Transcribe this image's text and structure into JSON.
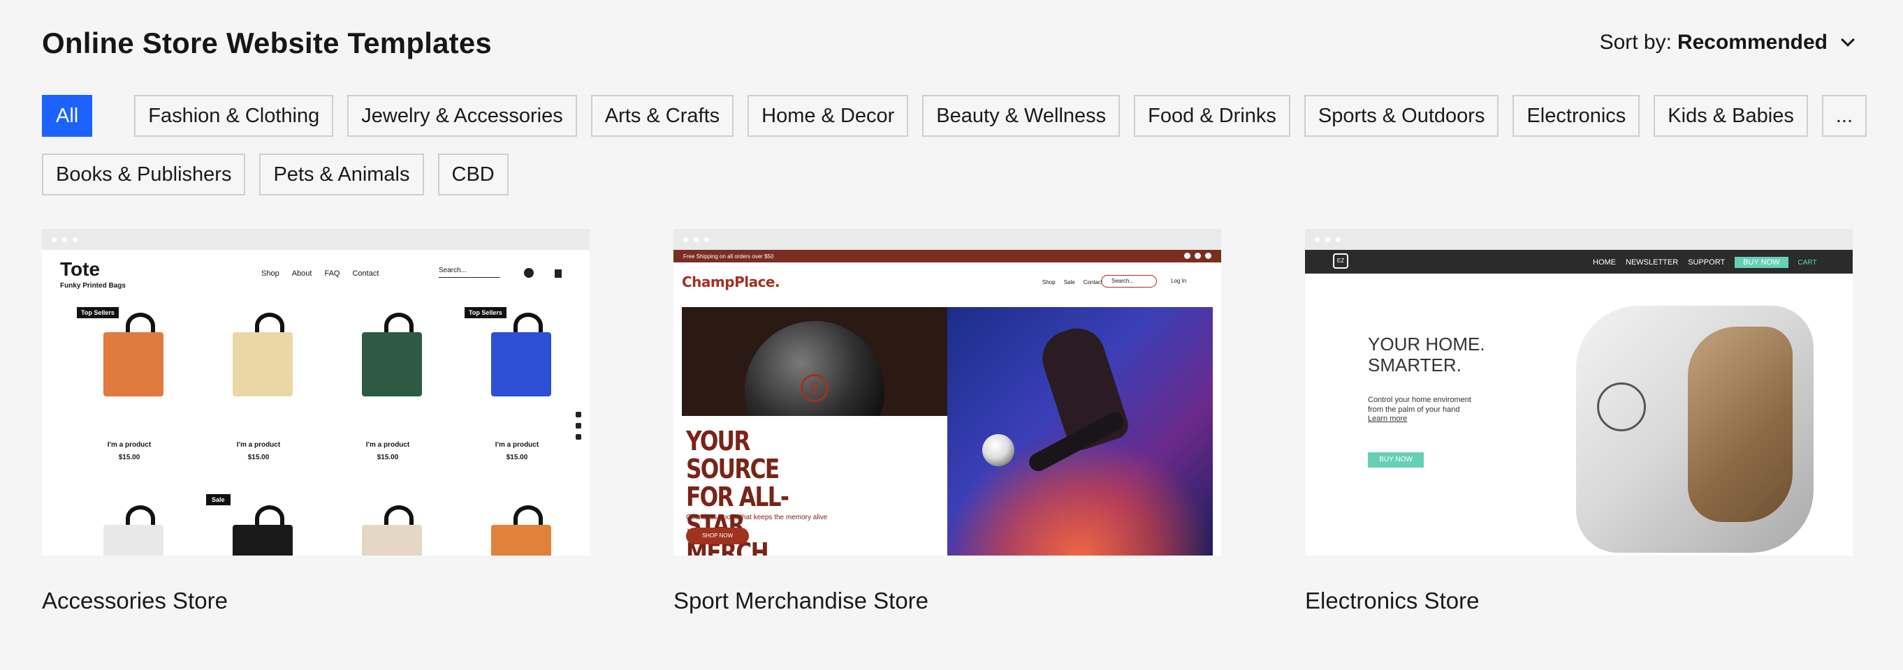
{
  "header": {
    "title": "Online Store Website Templates",
    "sort_label": "Sort by:",
    "sort_value": "Recommended"
  },
  "filters": {
    "all": "All",
    "row1": [
      "Fashion & Clothing",
      "Jewelry & Accessories",
      "Arts & Crafts",
      "Home & Decor",
      "Beauty & Wellness",
      "Food & Drinks",
      "Sports & Outdoors",
      "Electronics",
      "Kids & Babies"
    ],
    "more": "...",
    "row2": [
      "Books & Publishers",
      "Pets & Animals",
      "CBD"
    ]
  },
  "templates": [
    {
      "name": "Accessories Store",
      "preview": {
        "logo": "Tote",
        "subtitle": "Funky Printed Bags",
        "nav": [
          "Shop",
          "About",
          "FAQ",
          "Contact"
        ],
        "search": "Search...",
        "badges": {
          "top_sellers": "Top Sellers",
          "sale": "Sale"
        },
        "product_name": "I'm a product",
        "product_price": "$15.00",
        "bag_colors": [
          "#e07a3f",
          "#e9d7a5",
          "#2e5a44",
          "#2f4fd6",
          "#e8e8e8",
          "#1a1a1a",
          "#e4d7c6",
          "#e0823a"
        ]
      }
    },
    {
      "name": "Sport Merchandise Store",
      "preview": {
        "banner": "Free Shipping on all orders over $50",
        "logo": "ChampPlace.",
        "nav": [
          "Shop",
          "Sale",
          "Contact"
        ],
        "search": "Search...",
        "login": "Log In",
        "ball_number": "8",
        "headline": "YOUR SOURCE FOR ALL-STAR MERCH",
        "tagline": "Countless goods that keeps the memory alive",
        "cta": "SHOP NOW"
      }
    },
    {
      "name": "Electronics Store",
      "preview": {
        "logo": "EZ",
        "nav": [
          "HOME",
          "NEWSLETTER",
          "SUPPORT"
        ],
        "buy_top": "BUY NOW",
        "cart": "CART",
        "headline_1": "YOUR HOME.",
        "headline_2": "SMARTER.",
        "desc_1": "Control your home enviroment",
        "desc_2": "from the palm of your hand",
        "learn": "Learn more",
        "cta": "BUY NOW"
      }
    }
  ]
}
